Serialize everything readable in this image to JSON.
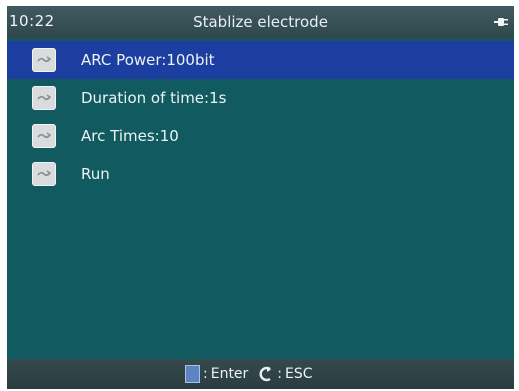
{
  "status_bar": {
    "time": "10:22",
    "title": "Stablize electrode",
    "power_icon": "plug-icon"
  },
  "menu": {
    "items": [
      {
        "label": "ARC Power:100bit",
        "icon": "arrow-icon",
        "selected": true
      },
      {
        "label": "Duration of time:1s",
        "icon": "arrow-icon",
        "selected": false
      },
      {
        "label": "Arc Times:10",
        "icon": "arrow-icon",
        "selected": false
      },
      {
        "label": "Run",
        "icon": "arrow-icon",
        "selected": false
      }
    ]
  },
  "footer": {
    "enter_label": "Enter",
    "esc_label": "ESC",
    "separator": ":",
    "enter_icon": "enter-key-icon",
    "esc_icon": "back-arrow-icon"
  },
  "colors": {
    "background": "#105a60",
    "selected": "#1c3ea0",
    "bars": "#2e474c"
  }
}
